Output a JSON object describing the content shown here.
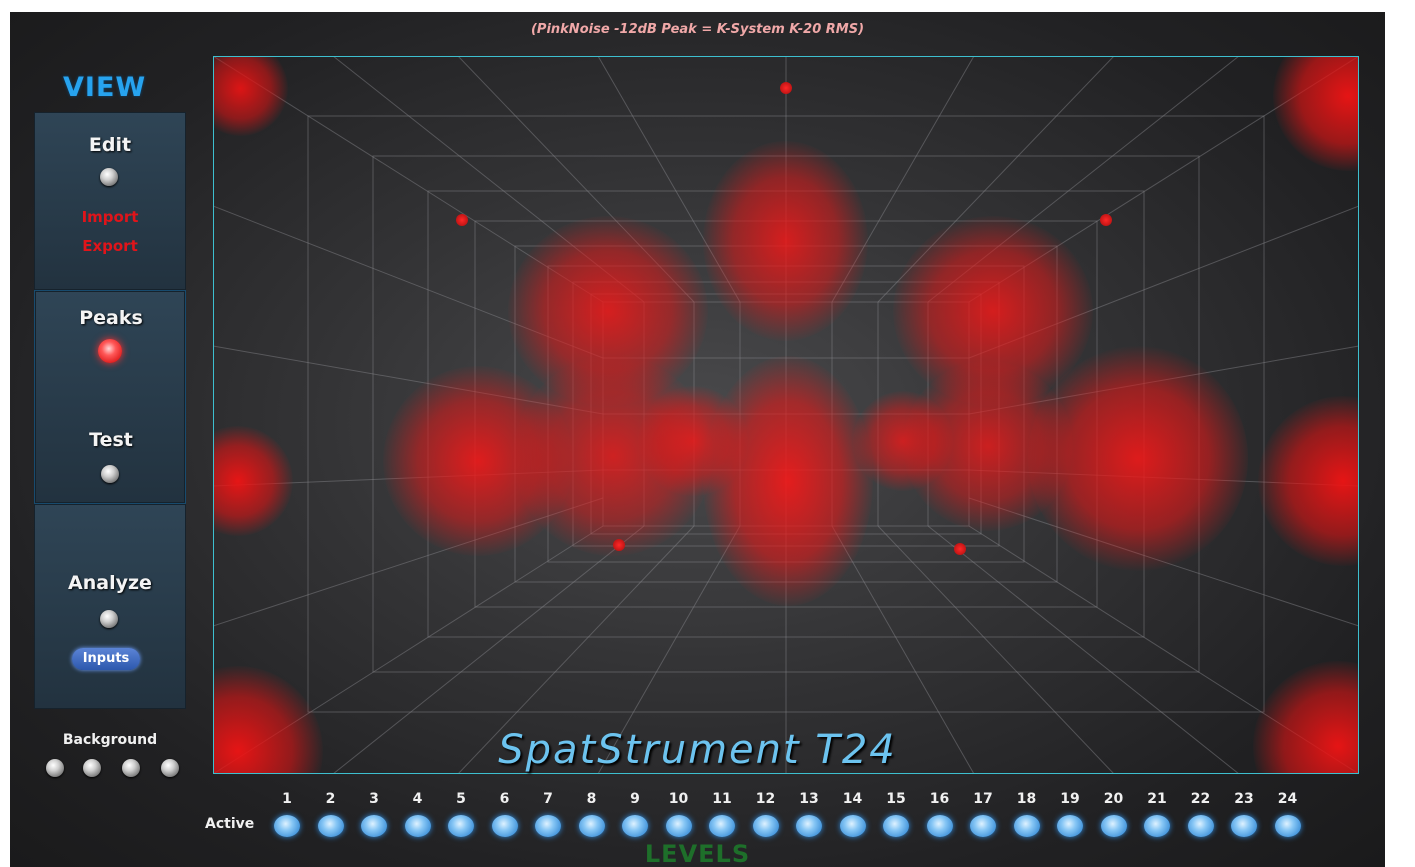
{
  "header": {
    "subtitle": "(PinkNoise -12dB Peak = K-System K-20 RMS)"
  },
  "sidebar": {
    "title": "VIEW",
    "edit": {
      "label": "Edit",
      "import_label": "Import",
      "export_label": "Export"
    },
    "peaks": {
      "label": "Peaks",
      "active": true
    },
    "test": {
      "label": "Test"
    },
    "analyze": {
      "label": "Analyze",
      "inputs_label": "Inputs"
    },
    "background": {
      "label": "Background",
      "options": 4
    }
  },
  "brand": {
    "title": "SpatStrument T24"
  },
  "channels": {
    "active_label": "Active",
    "numbers": [
      "1",
      "2",
      "3",
      "4",
      "5",
      "6",
      "7",
      "8",
      "9",
      "10",
      "11",
      "12",
      "13",
      "14",
      "15",
      "16",
      "17",
      "18",
      "19",
      "20",
      "21",
      "22",
      "23",
      "24"
    ]
  },
  "footer": {
    "levels_label": "LEVELS"
  },
  "colors": {
    "accent": "#27a3ef",
    "peak_red": "#ff2020",
    "frame": "#3dbfcf",
    "led_blue": "#3c8fd8",
    "levels_green": "#1e6f2a"
  }
}
